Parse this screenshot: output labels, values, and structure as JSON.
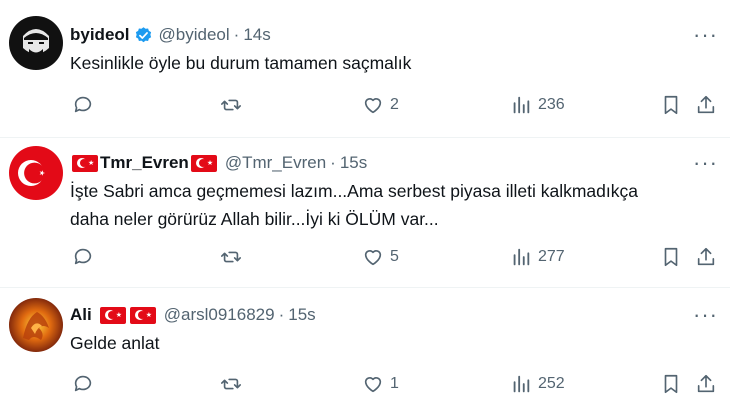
{
  "tweets": [
    {
      "name": "byideol",
      "handle": "@byideol",
      "time": "14s",
      "text": "Kesinlikle öyle bu durum tamamen saçmalık",
      "likes": "2",
      "views": "236"
    },
    {
      "name": "Tmr_Evren",
      "handle": "@Tmr_Evren",
      "time": "15s",
      "text_line1": "İşte Sabri amca geçmemesi lazım...Ama serbest piyasa illeti kalkmadıkça",
      "text_line2": "daha neler görürüz Allah bilir...İyi ki ÖLÜM var...",
      "likes": "5",
      "views": "277"
    },
    {
      "name": "Ali",
      "handle": "@arsl0916829",
      "time": "15s",
      "text": "Gelde anlat",
      "likes": "1",
      "views": "252"
    }
  ],
  "ui": {
    "separator": "·",
    "more_glyph": "···"
  },
  "colors": {
    "verified": "#1d9bf0",
    "muted": "#536471",
    "flag_red": "#e30a17"
  }
}
